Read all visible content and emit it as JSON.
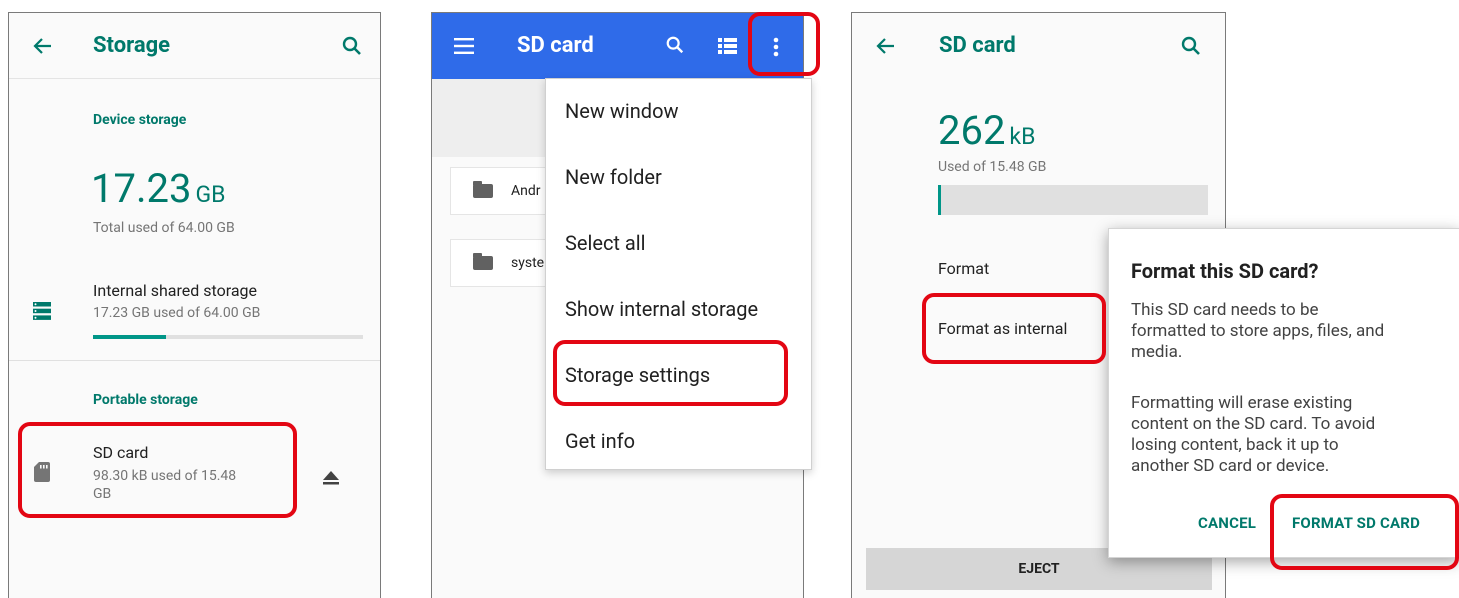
{
  "panel1": {
    "title": "Storage",
    "device_storage_header": "Device storage",
    "total_used_value": "17.23",
    "total_used_unit": "GB",
    "total_used_caption": "Total used of 64.00 GB",
    "internal": {
      "title": "Internal shared storage",
      "subtitle": "17.23 GB used of 64.00 GB",
      "progress_fraction": 0.27
    },
    "portable_storage_header": "Portable storage",
    "sd_card": {
      "title": "SD card",
      "subtitle_line1": "98.30 kB used of 15.48",
      "subtitle_line2": "GB"
    }
  },
  "panel2": {
    "title": "SD card",
    "folders": [
      "Andr",
      "syste"
    ],
    "menu_items": [
      "New window",
      "New folder",
      "Select all",
      "Show internal storage",
      "Storage settings",
      "Get info"
    ]
  },
  "panel3": {
    "title": "SD card",
    "used_value": "262",
    "used_unit": "kB",
    "used_caption": "Used of 15.48 GB",
    "used_fraction": 0.01,
    "format_label": "Format",
    "format_internal_label": "Format as internal",
    "eject_label": "EJECT",
    "dialog": {
      "title": "Format this SD card?",
      "body1_line1": "This SD card needs to be",
      "body1_line2": "formatted to store apps, files, and",
      "body1_line3": "media.",
      "body2_line1": "Formatting will erase existing",
      "body2_line2": "content on the SD card. To avoid",
      "body2_line3": "losing content, back it up to",
      "body2_line4": "another SD card or device.",
      "cancel_label": "CANCEL",
      "format_label": "FORMAT SD CARD"
    }
  },
  "colors": {
    "accent_teal": "#00796b",
    "progress_teal": "#009688",
    "app_bar_blue": "#2f6be9",
    "highlight_red": "#e30613"
  }
}
